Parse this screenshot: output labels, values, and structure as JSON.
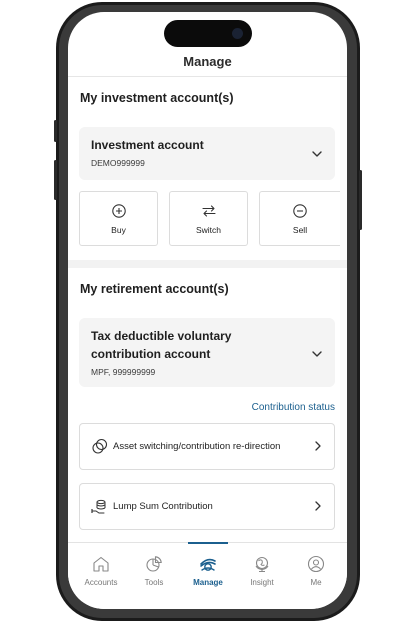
{
  "header": {
    "title": "Manage"
  },
  "investment": {
    "heading": "My investment account(s)",
    "account_name": "Investment account",
    "account_id": "DEMO999999",
    "actions": [
      {
        "label": "Buy",
        "icon": "plus-circle-icon"
      },
      {
        "label": "Switch",
        "icon": "switch-arrows-icon"
      },
      {
        "label": "Sell",
        "icon": "minus-circle-icon"
      }
    ]
  },
  "retirement": {
    "heading": "My retirement account(s)",
    "account_name_line1": "Tax deductible voluntary",
    "account_name_line2": "contribution account",
    "account_id": "MPF, 999999999",
    "status_link": "Contribution status",
    "rows": [
      {
        "label": "Asset switching/contribution re-direction",
        "icon": "asset-switch-icon"
      },
      {
        "label": "Lump Sum Contribution",
        "icon": "lump-sum-icon"
      }
    ]
  },
  "tabbar": {
    "active": "Manage",
    "tabs": [
      {
        "label": "Accounts",
        "icon": "home-icon"
      },
      {
        "label": "Tools",
        "icon": "pie-chart-icon"
      },
      {
        "label": "Manage",
        "icon": "manage-icon"
      },
      {
        "label": "Insight",
        "icon": "globe-icon"
      },
      {
        "label": "Me",
        "icon": "user-icon"
      }
    ]
  },
  "colors": {
    "accent": "#1b5f8e",
    "card_bg": "#f4f4f4",
    "text": "#1f1f1f"
  }
}
